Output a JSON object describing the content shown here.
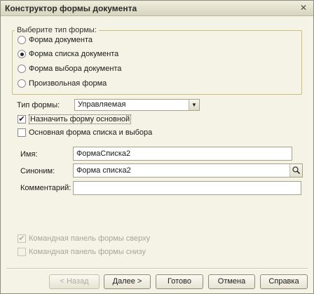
{
  "window": {
    "title": "Конструктор формы документа"
  },
  "form_type_group": {
    "caption": "Выберите тип формы:",
    "options": [
      {
        "label": "Форма документа",
        "selected": false
      },
      {
        "label": "Форма списка документа",
        "selected": true
      },
      {
        "label": "Форма выбора документа",
        "selected": false
      },
      {
        "label": "Произвольная форма",
        "selected": false
      }
    ]
  },
  "form_kind": {
    "label": "Тип формы:",
    "value": "Управляемая"
  },
  "checkboxes": {
    "set_main": {
      "label": "Назначить форму основной",
      "checked": true
    },
    "main_list_choice": {
      "label": "Основная форма списка и выбора",
      "checked": false
    },
    "cmd_panel_top": {
      "label": "Командная панель формы сверху",
      "checked": true,
      "disabled": true
    },
    "cmd_panel_bottom": {
      "label": "Командная панель формы снизу",
      "checked": false,
      "disabled": true
    }
  },
  "fields": {
    "name": {
      "label": "Имя:",
      "value": "ФормаСписка2"
    },
    "synonym": {
      "label": "Синоним:",
      "value": "Форма списка2"
    },
    "comment": {
      "label": "Комментарий:",
      "value": ""
    }
  },
  "buttons": {
    "back": "< Назад",
    "next": "Далее >",
    "done": "Готово",
    "cancel": "Отмена",
    "help": "Справка"
  }
}
